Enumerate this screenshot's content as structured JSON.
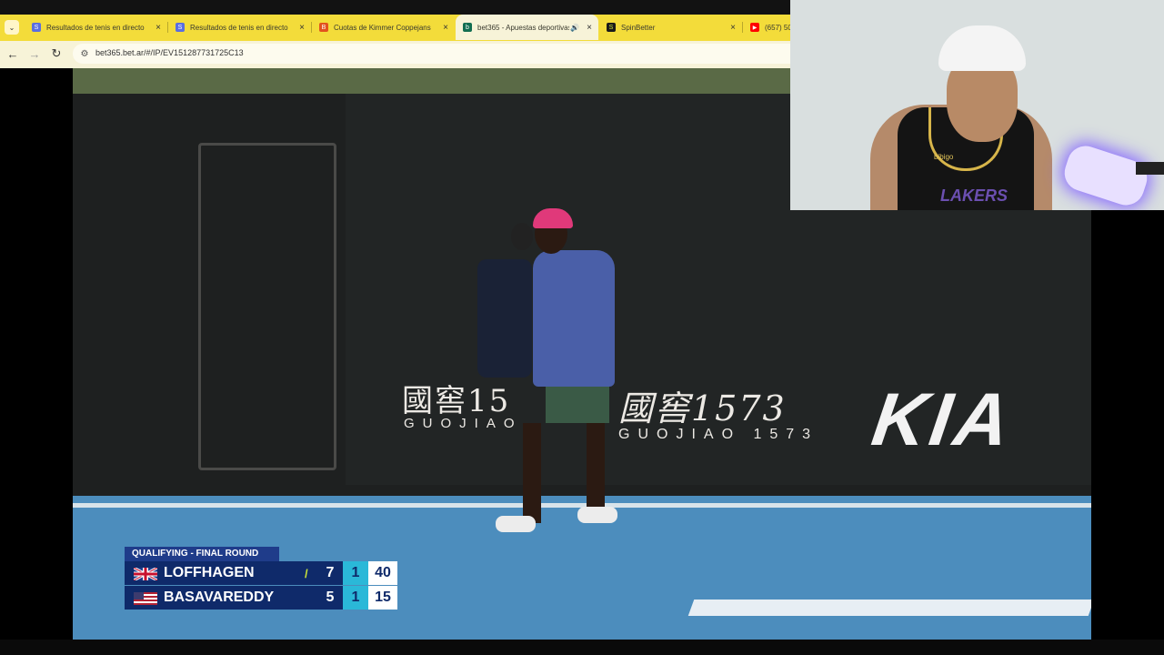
{
  "browser": {
    "tabs": [
      {
        "title": "Resultados de tenis en directo",
        "favicon_color": "#5a6ee0",
        "favicon_glyph": "S",
        "active": false
      },
      {
        "title": "Resultados de tenis en directo",
        "favicon_color": "#5a6ee0",
        "favicon_glyph": "S",
        "active": false
      },
      {
        "title": "Cuotas de Kimmer Coppejans",
        "favicon_color": "#e2521d",
        "favicon_glyph": "B",
        "active": false
      },
      {
        "title": "bet365 - Apuestas deportivas",
        "favicon_color": "#126e51",
        "favicon_glyph": "b",
        "active": true
      },
      {
        "title": "SpinBetter",
        "favicon_color": "#1a1a1a",
        "favicon_glyph": "S",
        "active": false
      },
      {
        "title": "(657) 50",
        "favicon_color": "#ff0000",
        "favicon_glyph": "▶",
        "active": false
      }
    ],
    "close_glyph": "×",
    "audio_glyph": "🔊",
    "tab_menu_glyph": "⌄",
    "nav": {
      "back": "←",
      "forward": "→",
      "reload": "↻"
    },
    "site_info_glyph": "⚙",
    "url": "bet365.bet.ar/#/IP/EV151287731725C13"
  },
  "video": {
    "sponsor_chinese": "國窖1573",
    "sponsor_chinese_short": "國窖15",
    "sponsor_romanized": "GUOJIAO 1573",
    "sponsor_romanized_short": "GUOJIAO",
    "brand": "KIA"
  },
  "scoreboard": {
    "round": "QUALIFYING - FINAL ROUND",
    "players": [
      {
        "name": "LOFFHAGEN",
        "flag": "gb",
        "serving": true,
        "serve_glyph": "/",
        "set1": "7",
        "set2": "1",
        "points": "40"
      },
      {
        "name": "BASAVAREDDY",
        "flag": "us",
        "serving": false,
        "serve_glyph": "",
        "set1": "5",
        "set2": "1",
        "points": "15"
      }
    ]
  },
  "webcam": {
    "jersey_text": "LAKERS",
    "sponsor_text": "bibigo"
  }
}
